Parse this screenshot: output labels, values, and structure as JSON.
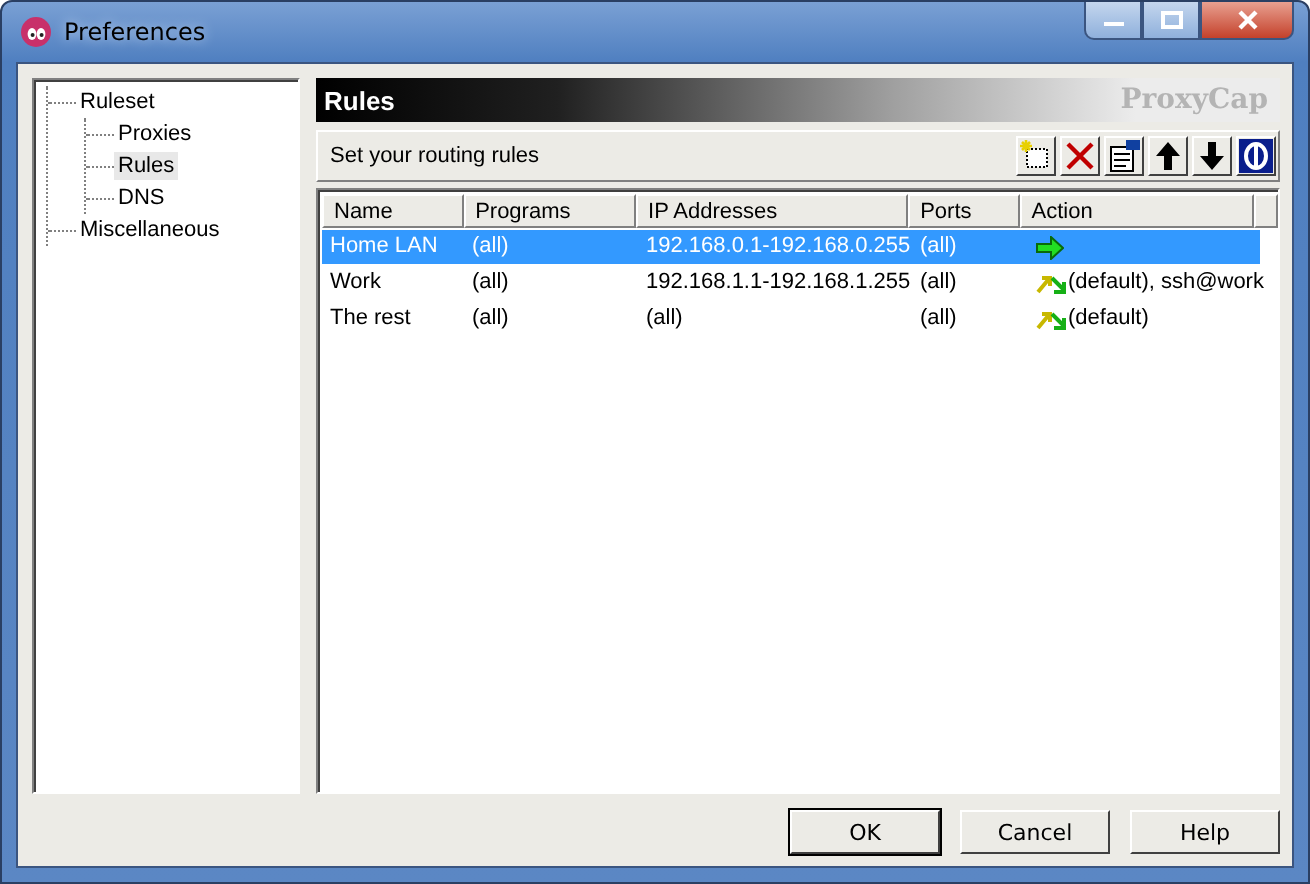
{
  "window": {
    "title": "Preferences"
  },
  "tree": [
    {
      "label": "Ruleset",
      "selected": false,
      "children": [
        {
          "label": "Proxies",
          "selected": false
        },
        {
          "label": "Rules",
          "selected": true
        },
        {
          "label": "DNS",
          "selected": false
        }
      ]
    },
    {
      "label": "Miscellaneous",
      "selected": false
    }
  ],
  "panel": {
    "title": "Rules",
    "brand": "ProxyCap",
    "hint": "Set your routing rules"
  },
  "toolbar": [
    {
      "kind": "new"
    },
    {
      "kind": "delete"
    },
    {
      "kind": "properties"
    },
    {
      "kind": "up"
    },
    {
      "kind": "down"
    },
    {
      "kind": "toggle"
    }
  ],
  "table": {
    "columns": [
      "Name",
      "Programs",
      "IP Addresses",
      "Ports",
      "Action"
    ],
    "rows": [
      {
        "selected": true,
        "cells": [
          "Home LAN",
          "(all)",
          "192.168.0.1-192.168.0.255",
          "(all)"
        ],
        "action": {
          "kind": "direct"
        }
      },
      {
        "selected": false,
        "cells": [
          "Work",
          "(all)",
          "192.168.1.1-192.168.1.255",
          "(all)"
        ],
        "action": {
          "kind": "proxy",
          "text": "(default), ssh@work"
        }
      },
      {
        "selected": false,
        "cells": [
          "The rest",
          "(all)",
          "(all)",
          "(all)"
        ],
        "action": {
          "kind": "proxy",
          "text": "(default)"
        }
      }
    ]
  },
  "buttons": [
    "OK",
    "Cancel",
    "Help"
  ]
}
